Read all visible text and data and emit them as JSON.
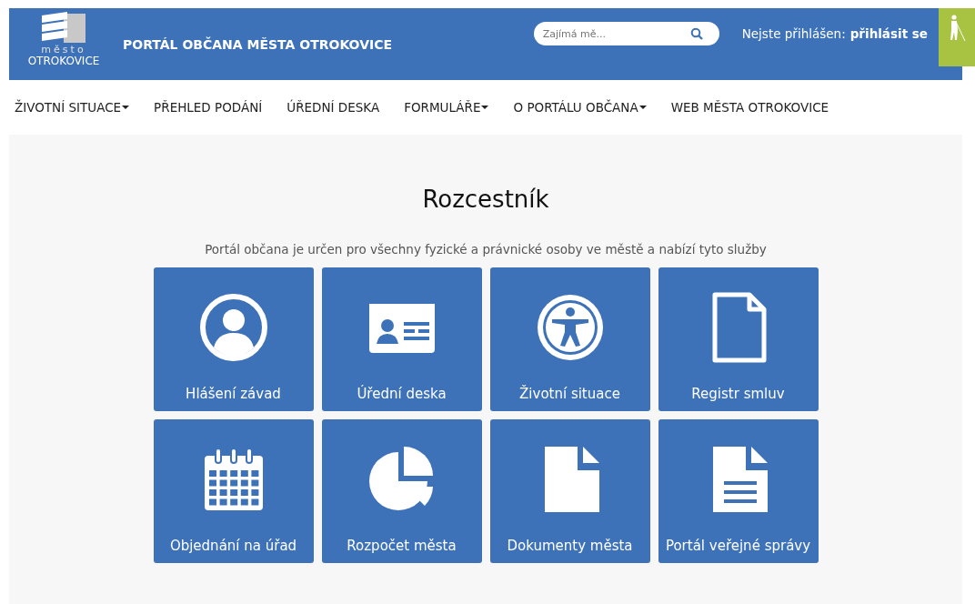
{
  "header": {
    "logo_top": "město",
    "logo_bottom": "OTROKOVICE",
    "title": "PORTÁL OBČANA MĚSTA OTROKOVICE",
    "search": {
      "placeholder": "Zajímá mě..."
    },
    "login_label": "Nejste přihlášen:",
    "login_link": "přihlásit se"
  },
  "nav": [
    {
      "label": "ŽIVOTNÍ SITUACE",
      "dropdown": true
    },
    {
      "label": "PŘEHLED PODÁNÍ",
      "dropdown": false
    },
    {
      "label": "ÚŘEDNÍ DESKA",
      "dropdown": false
    },
    {
      "label": "FORMULÁŘE",
      "dropdown": true
    },
    {
      "label": "O PORTÁLU OBČANA",
      "dropdown": true
    },
    {
      "label": "WEB MĚSTA OTROKOVICE",
      "dropdown": false
    }
  ],
  "heading": "Rozcestník",
  "intro": "Portál občana je určen pro všechny fyzické a právnické osoby ve městě a nabízí tyto služby",
  "tiles": [
    {
      "label": "Hlášení závad",
      "kind": "user"
    },
    {
      "label": "Úřední deska",
      "kind": "card"
    },
    {
      "label": "Životní situace",
      "kind": "access"
    },
    {
      "label": "Registr smluv",
      "kind": "file"
    },
    {
      "label": "Objednání na úřad",
      "kind": "calendar"
    },
    {
      "label": "Rozpočet města",
      "kind": "pie"
    },
    {
      "label": "Dokumenty města",
      "kind": "filesolid"
    },
    {
      "label": "Portál veřejné správy",
      "kind": "filetext"
    }
  ]
}
